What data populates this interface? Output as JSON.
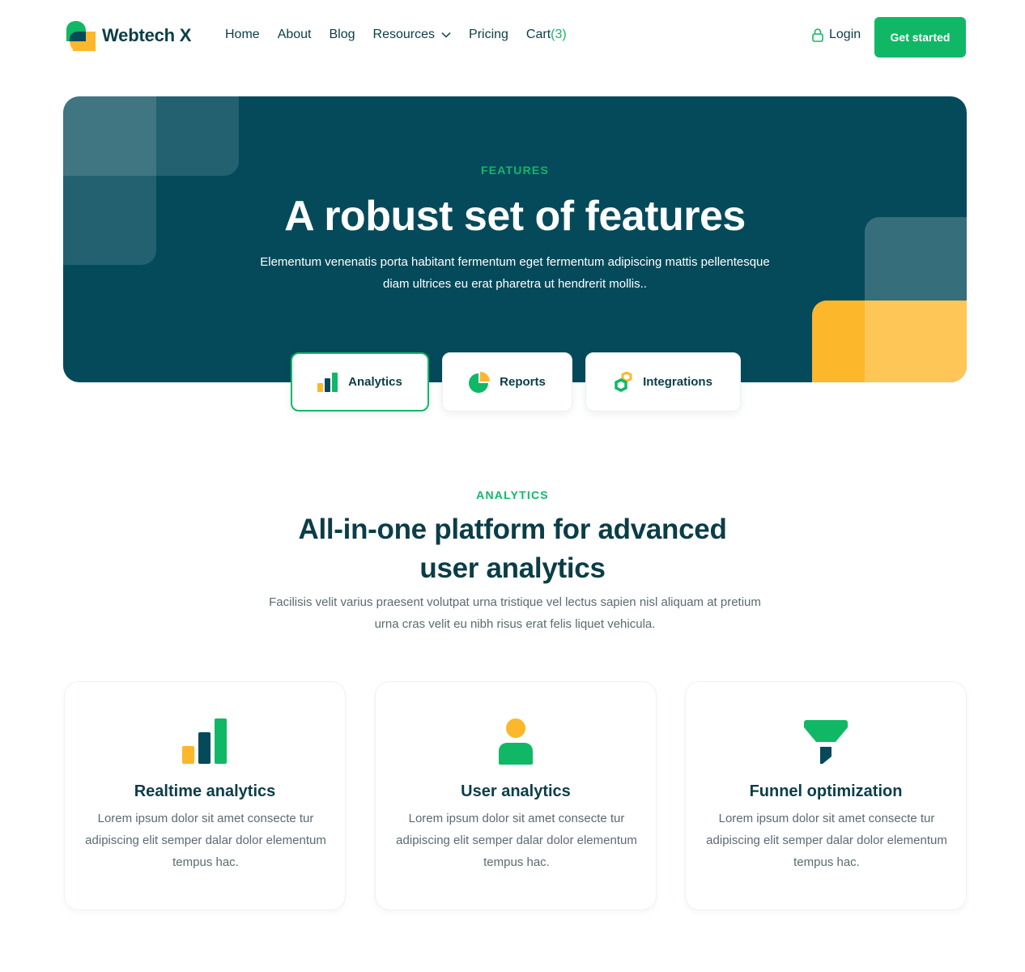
{
  "brand": {
    "name": "Webtech X",
    "colors": {
      "primary": "#10b866",
      "dark": "#044a5b",
      "text": "#0b3d47",
      "accent": "#fdb72a"
    }
  },
  "nav": {
    "items": [
      {
        "label": "Home"
      },
      {
        "label": "About"
      },
      {
        "label": "Blog"
      },
      {
        "label": "Resources",
        "dropdown": true
      },
      {
        "label": "Pricing"
      }
    ],
    "cart": {
      "label": "Cart",
      "count": "(3)"
    },
    "login_label": "Login",
    "cta_label": "Get started"
  },
  "hero": {
    "eyebrow": "FEATURES",
    "title": "A robust set of features",
    "description": "Elementum venenatis porta habitant fermentum eget fermentum adipiscing mattis pellentesque diam ultrices eu erat pharetra ut hendrerit mollis.."
  },
  "tabs": [
    {
      "label": "Analytics",
      "icon": "bar-chart-icon",
      "active": true
    },
    {
      "label": "Reports",
      "icon": "pie-chart-icon",
      "active": false
    },
    {
      "label": "Integrations",
      "icon": "hexagon-nuts-icon",
      "active": false
    }
  ],
  "section": {
    "eyebrow": "ANALYTICS",
    "title": "All-in-one platform for advanced user analytics",
    "description": "Facilisis velit varius praesent volutpat urna tristique vel lectus sapien nisl aliquam at pretium urna cras velit eu nibh risus erat felis liquet vehicula."
  },
  "cards": [
    {
      "icon": "bar-chart-icon",
      "title": "Realtime analytics",
      "description": "Lorem ipsum dolor sit amet consecte tur adipiscing elit semper dalar dolor elementum tempus hac."
    },
    {
      "icon": "user-icon",
      "title": "User analytics",
      "description": "Lorem ipsum dolor sit amet consecte tur adipiscing elit semper dalar dolor elementum tempus hac."
    },
    {
      "icon": "funnel-icon",
      "title": "Funnel optimization",
      "description": "Lorem ipsum dolor sit amet consecte tur adipiscing elit semper dalar dolor elementum tempus hac."
    }
  ]
}
